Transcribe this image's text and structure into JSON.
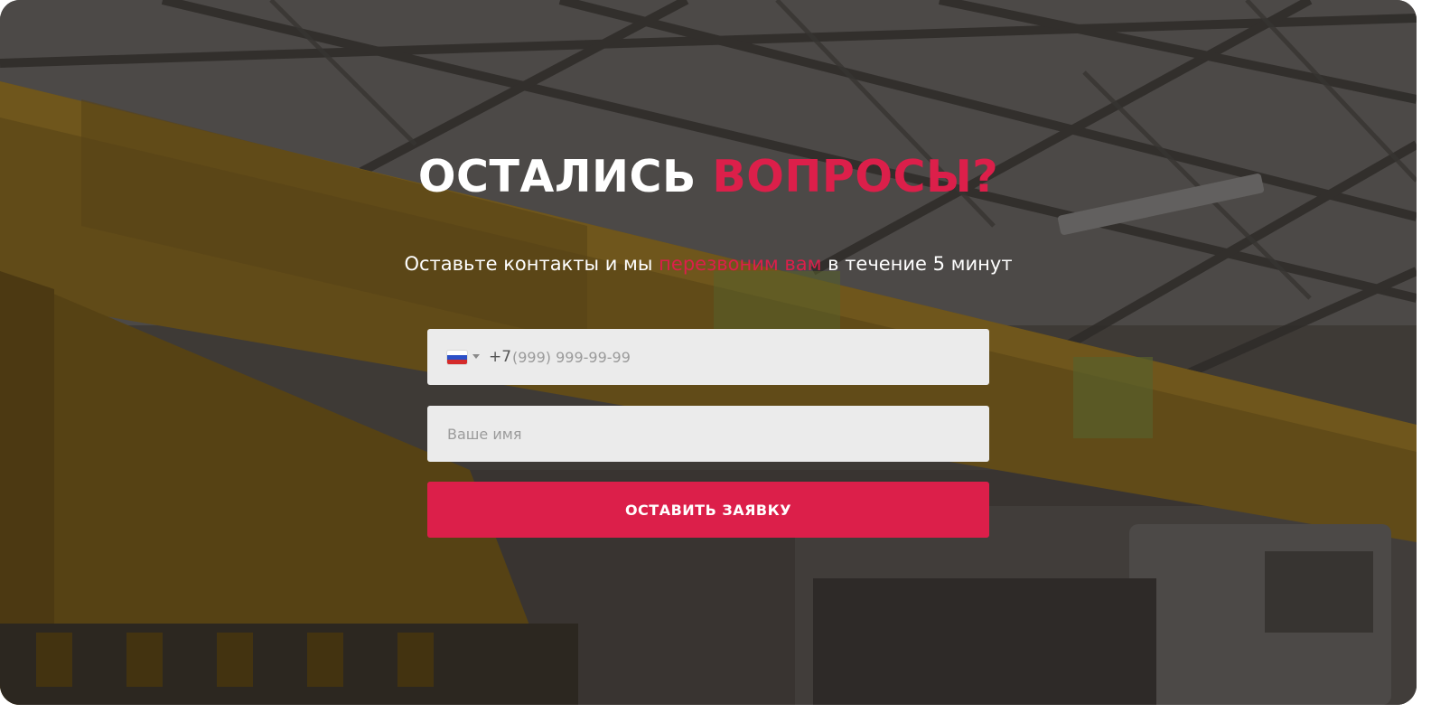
{
  "colors": {
    "accent": "#dc1f4a",
    "field_background": "#ebebeb",
    "text_light": "#ffffff"
  },
  "heading": {
    "title_main": "ОСТАЛИСЬ",
    "title_accent": "ВОПРОСЫ?"
  },
  "subtitle": {
    "before": "Оставьте контакты и мы",
    "accent": "перезвоним вам",
    "after": "в течение 5 минут"
  },
  "form": {
    "phone": {
      "country_flag_icon": "russia-flag-icon",
      "country_code": "+7",
      "placeholder": "(999) 999-99-99"
    },
    "name": {
      "placeholder": "Ваше имя"
    },
    "submit_label": "ОСТАВИТЬ ЗАЯВКУ"
  }
}
